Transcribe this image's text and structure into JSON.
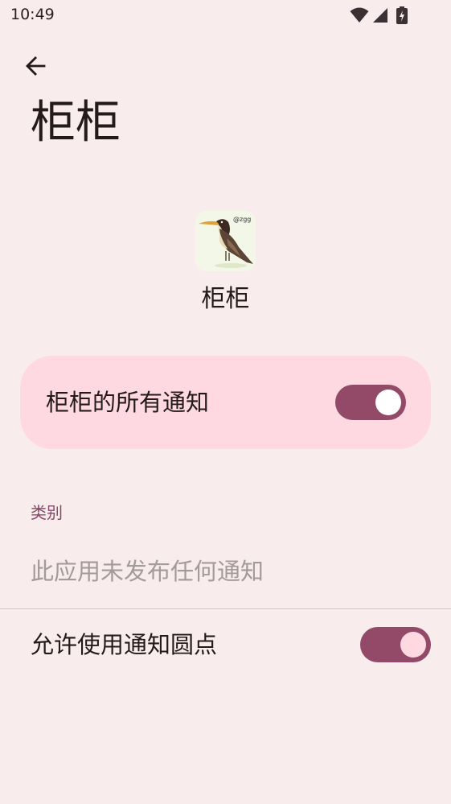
{
  "status_bar": {
    "time": "10:49",
    "icons": [
      "wifi-icon",
      "signal-icon",
      "battery-charging-icon"
    ]
  },
  "header": {
    "back_icon": "arrow-back-icon",
    "title": "柜柜"
  },
  "app": {
    "name": "柜柜",
    "icon": "bird-app-icon",
    "icon_text": "@zgg"
  },
  "master_toggle": {
    "label": "柜柜的所有通知",
    "checked": true
  },
  "categories": {
    "header": "类别",
    "empty_message": "此应用未发布任何通知"
  },
  "notification_dot": {
    "label": "允许使用通知圆点",
    "checked": true
  },
  "colors": {
    "background": "#f9ecec",
    "card": "#ffd9e2",
    "accent": "#924a68",
    "section_header": "#8a4566",
    "muted_text": "#a39a9c"
  }
}
